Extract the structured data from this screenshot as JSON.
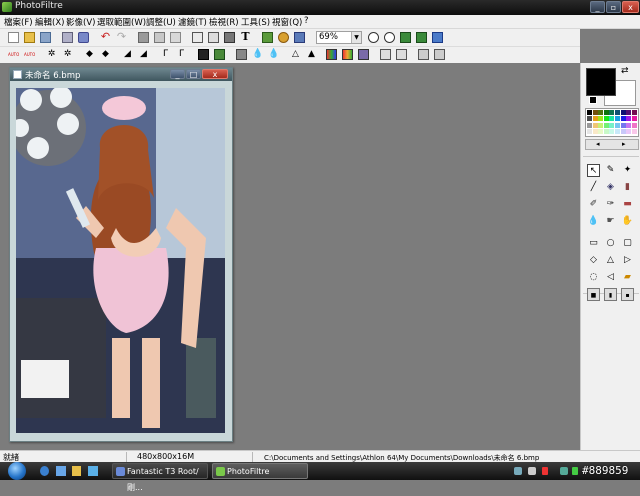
{
  "window": {
    "title": "PhotoFiltre"
  },
  "menu": [
    "檔案(F)",
    "編輯(X)",
    "影像(V)",
    "選取範圍(W)",
    "調整(U)",
    "濾鏡(T)",
    "檢視(R)",
    "工具(S)",
    "視窗(Q)",
    "?"
  ],
  "toolbar": {
    "zoom_value": "69%",
    "text_tool": "T"
  },
  "toolbar2": {
    "auto1": "AUTO",
    "auto2": "AUTO"
  },
  "document": {
    "title": "未命名 6.bmp"
  },
  "status": {
    "left": "就緒",
    "dimensions": "480x800x16M",
    "path": "C:\\Documents and Settings\\Athlon 64\\My Documents\\Downloads\\未命名 6.bmp"
  },
  "taskbar": {
    "tasks": [
      "Fantastic T3 Root/剛...",
      "PhotoFiltre"
    ],
    "tray_text": "#889859"
  },
  "colors": {
    "foreground": "#000000",
    "background": "#ffffff",
    "accent_title": "#1a1a1a"
  }
}
